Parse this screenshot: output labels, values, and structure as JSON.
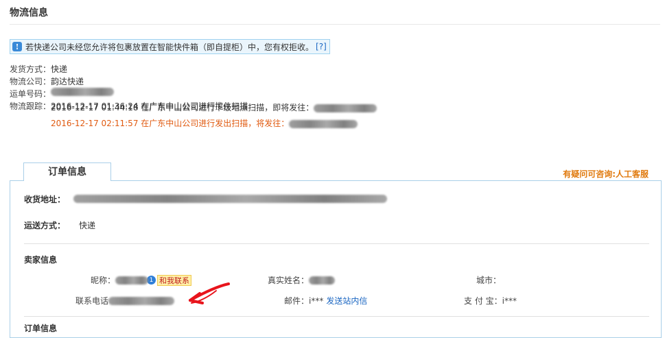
{
  "logistics": {
    "title": "物流信息",
    "notice": {
      "icon": "info-icon",
      "text": "若快递公司未经您允许将包裹放置在智能快件箱（即自提柜）中，您有权拒收。",
      "help_link": "[?]"
    },
    "ship_method_label": "发货方式：",
    "ship_method_value": "快递",
    "company_label": "物流公司：",
    "company_value": "韵达快递",
    "waybill_label": "运单号码：",
    "tracking_label": "物流跟踪：",
    "tracking": [
      {
        "text": "2016-12-17 01:36:24 在广东中山公司进行揽件扫描"
      },
      {
        "text": "2016-12-17 01:44:18 在广东中山公司进行下级地点扫描，即将发往："
      },
      {
        "text": "2016-12-17 02:11:57 在广东中山公司进行发出扫描，将发往："
      }
    ]
  },
  "order": {
    "tab_label": "订单信息",
    "help_link": "有疑问可咨询:人工客服",
    "address_label": "收货地址：",
    "delivery_label": "运送方式：",
    "delivery_value": "快递",
    "seller_title": "卖家信息",
    "nickname_label": "昵称：",
    "contact_badge": "和我联系",
    "realname_label": "真实姓名：",
    "city_label": "城市：",
    "phone_label": "联系电话",
    "email_label": "邮件：",
    "email_value": "i***",
    "email_link": "发送站内信",
    "alipay_label": "支 付 宝：",
    "alipay_value": "i***",
    "order_info_title": "订单信息"
  },
  "colors": {
    "accent_orange": "#e05a10",
    "link_blue": "#1a66c2",
    "annotation_red": "#e8141c"
  }
}
